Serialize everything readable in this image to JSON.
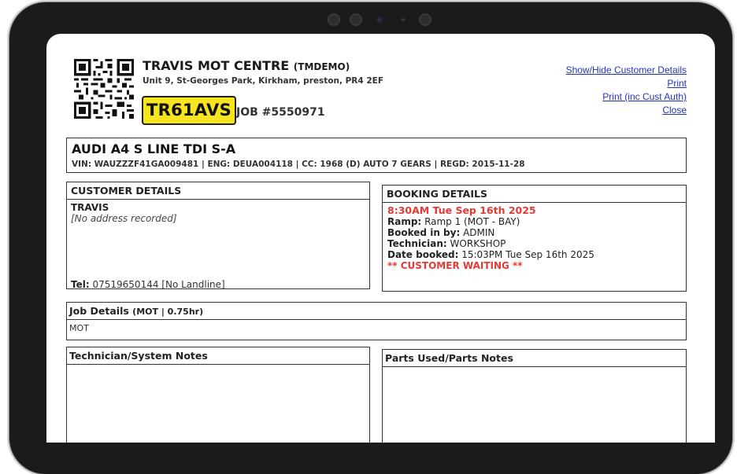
{
  "header": {
    "company_name": "TRAVIS MOT CENTRE",
    "company_code": "(TMDEMO)",
    "address": "Unit 9, St-Georges Park, Kirkham, preston, PR4 2EF",
    "registration": "TR61AVS",
    "job_number": "JOB #5550971"
  },
  "links": {
    "toggle_customer": "Show/Hide Customer Details",
    "print": "Print",
    "print_auth": "Print (inc Cust Auth)",
    "close": "Close"
  },
  "vehicle": {
    "title": "AUDI A4 S LINE TDI S-A",
    "spec": "VIN: WAUZZZF41GA009481 | ENG: DEUA004118 | CC: 1968 (D) AUTO 7 GEARS | REGD: 2015-11-28"
  },
  "customer": {
    "heading": "CUSTOMER DETAILS",
    "name": "TRAVIS",
    "address": "[No address recorded]",
    "tel_label": "Tel:",
    "tel_value": "07519650144 [No Landline]"
  },
  "booking": {
    "heading": "BOOKING DETAILS",
    "datetime": "8:30AM Tue Sep 16th 2025",
    "ramp_label": "Ramp:",
    "ramp_value": "Ramp 1 (MOT - BAY)",
    "booked_by_label": "Booked in by:",
    "booked_by_value": "ADMIN",
    "technician_label": "Technician:",
    "technician_value": "WORKSHOP",
    "date_booked_label": "Date booked:",
    "date_booked_value": "15:03PM Tue Sep 16th 2025",
    "waiting": "** CUSTOMER WAITING **"
  },
  "job_details": {
    "heading": "Job Details",
    "sub": "(MOT | 0.75hr)",
    "line": "MOT"
  },
  "notes": {
    "technician_heading": "Technician/System Notes",
    "parts_heading": "Parts Used/Parts Notes"
  },
  "icons": {
    "qr": "qr-code-icon"
  },
  "colors": {
    "plate_yellow": "#f5e41e",
    "link_blue": "#2233bb",
    "alert_red": "#e53935"
  }
}
